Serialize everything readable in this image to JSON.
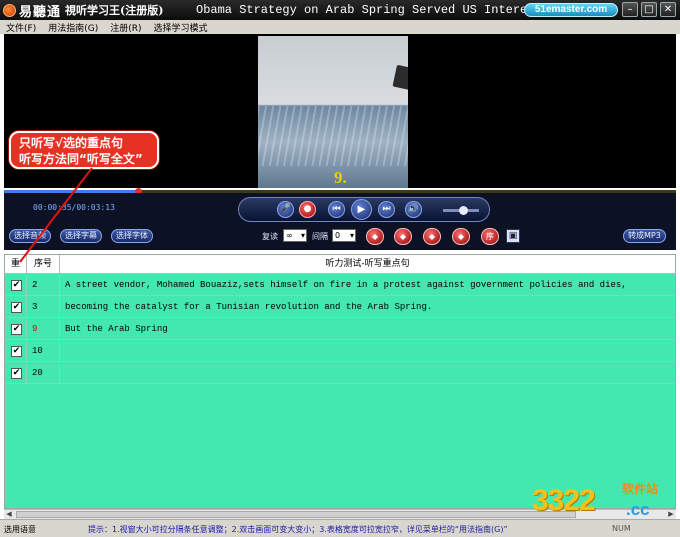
{
  "window": {
    "app_name": "易聽通",
    "app_subtitle": "視听学习王(注册版)",
    "file_title": "Obama Strategy on Arab Spring Served US Interests.avi",
    "site_badge": "51emaster.com",
    "minimize": "–",
    "maximize": "□",
    "close": "✕"
  },
  "menu": {
    "items": [
      "文件(F)",
      "用法指南(G)",
      "注册(R)",
      "选择学习模式"
    ]
  },
  "video": {
    "subtitle_number": "9."
  },
  "player": {
    "position_fraction": 0.2,
    "time_display": "00:00:35/00:03:13",
    "volume_fraction": 0.55,
    "select_audio": "选择音频",
    "select_subtitle": "选择字幕",
    "select_font": "选择字体",
    "repeat_label": "复读",
    "repeat_value": "∞",
    "interval_label": "间隔",
    "interval_value": "0",
    "seq_label": "序",
    "convert_mp3": "转成MP3"
  },
  "table": {
    "headers": {
      "check": "重",
      "number": "序号",
      "content": "听力测试-听写重点句"
    },
    "rows": [
      {
        "checked": "✔",
        "number": "2",
        "highlight": false,
        "text": "A street vendor, Mohamed Bouaziz,sets himself on fire in a protest against government policies and dies,"
      },
      {
        "checked": "✔",
        "number": "3",
        "highlight": false,
        "text": "becoming the catalyst for a Tunisian revolution and the Arab Spring."
      },
      {
        "checked": "✔",
        "number": "9",
        "highlight": true,
        "text": "But the Arab Spring"
      },
      {
        "checked": "✔",
        "number": "10",
        "highlight": false,
        "text": ""
      },
      {
        "checked": "✔",
        "number": "20",
        "highlight": false,
        "text": ""
      }
    ]
  },
  "callout": {
    "line1": "只听写√选的重点句",
    "line2": "听写方法同“听写全文”"
  },
  "status": {
    "left": "选用语意",
    "tip": "提示：1.视窗大小可拉分隔条任意调整；2.双击画面可变大变小；3.表格宽度可拉宽拉窄，详见菜单栏的“用法指南(G)”",
    "num": "NUM"
  },
  "watermark": {
    "digits": "3322",
    "cn": "软件站",
    "domain": ".cc"
  },
  "colors": {
    "table_background": "#42e8b0",
    "callout_background": "#e63222",
    "subtitle_number": "#e8d000",
    "highlight_number": "#d00000"
  }
}
